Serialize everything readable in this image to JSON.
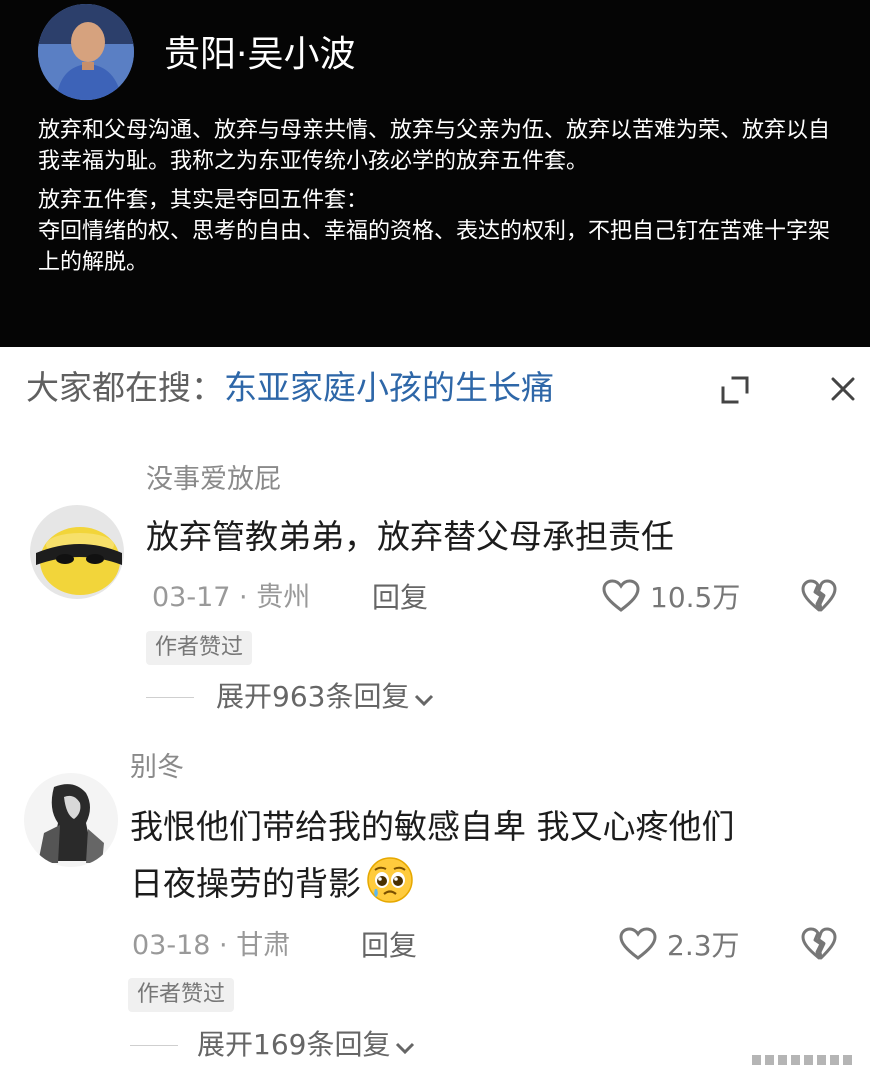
{
  "post": {
    "author": "贵阳·吴小波",
    "paragraph1": "放弃和父母沟通、放弃与母亲共情、放弃与父亲为伍、放弃以苦难为荣、放弃以自我幸福为耻。我称之为东亚传统小孩必学的放弃五件套。",
    "paragraph2_line1": "放弃五件套，其实是夺回五件套：",
    "paragraph2_line2": "夺回情绪的权、思考的自由、幸福的资格、表达的权利，不把自己钉在苦难十字架上的解脱。"
  },
  "search": {
    "label": "大家都在搜：",
    "query": "东亚家庭小孩的生长痛"
  },
  "comments": [
    {
      "username": "没事爱放屁",
      "text": "放弃管教弟弟，放弃替父母承担责任",
      "date": "03-17",
      "location": "贵州",
      "reply_label": "回复",
      "likes": "10.5万",
      "badge": "作者赞过",
      "expand_label": "展开963条回复"
    },
    {
      "username": "别冬",
      "text_line1": "我恨他们带给我的敏感自卑 我又心疼他们",
      "text_line2": "日夜操劳的背影",
      "emoji": "pleading-face",
      "date": "03-18",
      "location": "甘肃",
      "reply_label": "回复",
      "likes": "2.3万",
      "badge": "作者赞过",
      "expand_label": "展开169条回复"
    }
  ],
  "icons": {
    "expand": "expand-icon",
    "close": "close-icon",
    "like": "heart-outline-icon",
    "dislike": "broken-heart-icon",
    "chevron": "chevron-down-icon"
  },
  "colors": {
    "post_background": "#050505",
    "search_query": "#2e67a8",
    "text_primary": "#1c1c1c",
    "text_secondary": "#999999"
  }
}
